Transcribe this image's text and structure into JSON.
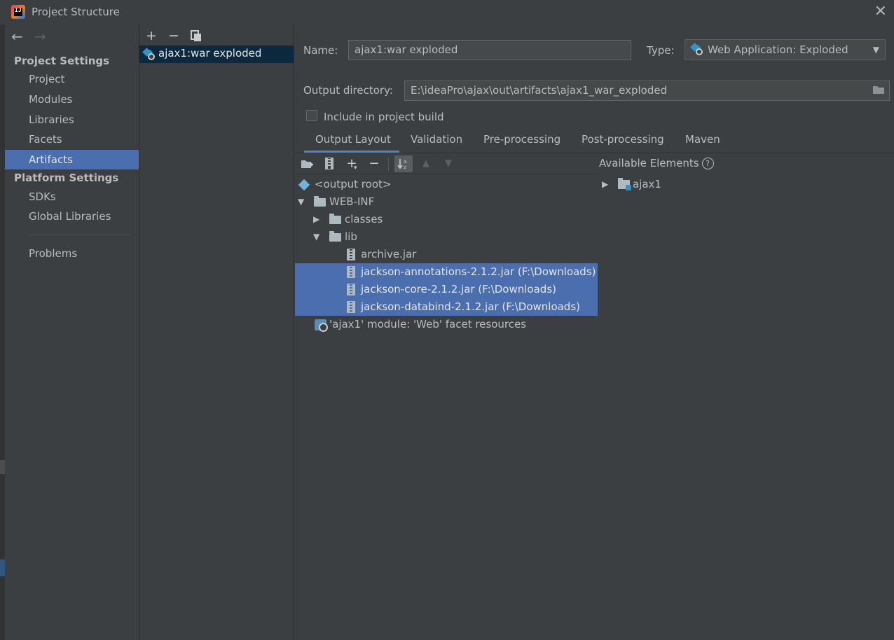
{
  "window": {
    "title": "Project Structure",
    "app_icon_text": "IJ"
  },
  "sidebar": {
    "project_settings_header": "Project Settings",
    "project_items": [
      "Project",
      "Modules",
      "Libraries",
      "Facets",
      "Artifacts"
    ],
    "selected_item": "Artifacts",
    "platform_settings_header": "Platform Settings",
    "platform_items": [
      "SDKs",
      "Global Libraries"
    ],
    "problems": "Problems"
  },
  "artifacts": {
    "toolbar": {
      "add": "+",
      "remove": "−"
    },
    "list": [
      {
        "label": "ajax1:war exploded",
        "icon": "web-artifact-icon",
        "selected": true
      }
    ]
  },
  "form": {
    "name_label": "Name:",
    "name_value": "ajax1:war exploded",
    "type_label": "Type:",
    "type_value": "Web Application: Exploded",
    "output_dir_label": "Output directory:",
    "output_dir_value": "E:\\ideaPro\\ajax\\out\\artifacts\\ajax1_war_exploded",
    "include_build_label": "Include in project build",
    "include_build_checked": false
  },
  "tabs": [
    "Output Layout",
    "Validation",
    "Pre-processing",
    "Post-processing",
    "Maven"
  ],
  "active_tab": "Output Layout",
  "output_tree": [
    {
      "label": "<output root>",
      "kind": "output-root",
      "depth": 0
    },
    {
      "label": "WEB-INF",
      "kind": "folder",
      "depth": 0,
      "expanded": true
    },
    {
      "label": "classes",
      "kind": "folder",
      "depth": 1,
      "expanded": false
    },
    {
      "label": "lib",
      "kind": "folder",
      "depth": 1,
      "expanded": true
    },
    {
      "label": "archive.jar",
      "kind": "jar",
      "depth": 2,
      "selected": false
    },
    {
      "label": "jackson-annotations-2.1.2.jar (F:\\Downloads)",
      "kind": "jar",
      "depth": 2,
      "selected": true
    },
    {
      "label": "jackson-core-2.1.2.jar (F:\\Downloads)",
      "kind": "jar",
      "depth": 2,
      "selected": true
    },
    {
      "label": "jackson-databind-2.1.2.jar (F:\\Downloads)",
      "kind": "jar",
      "depth": 2,
      "selected": true
    },
    {
      "label": "'ajax1' module: 'Web' facet resources",
      "kind": "facet",
      "depth": 0
    }
  ],
  "available": {
    "header": "Available Elements",
    "help": "?",
    "items": [
      {
        "label": "ajax1",
        "kind": "module",
        "expanded": false
      }
    ]
  },
  "colors": {
    "background": "#3c3f41",
    "selection": "#4b6eaf",
    "list_selection": "#0d293e",
    "text": "#bbbbbb",
    "accent": "#4a88c7"
  }
}
